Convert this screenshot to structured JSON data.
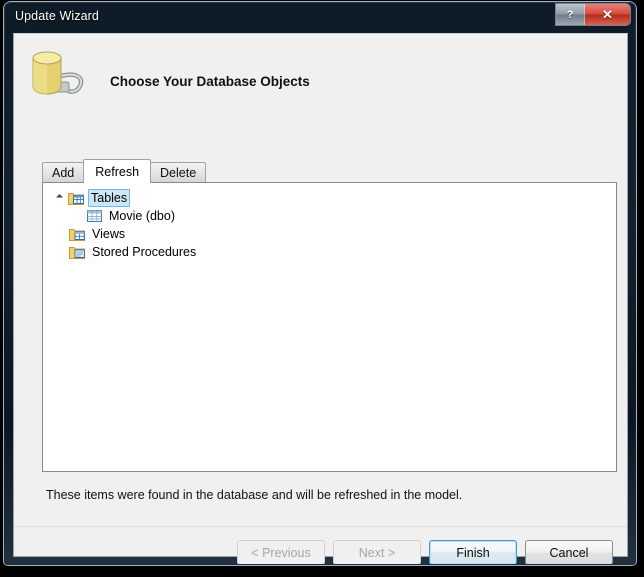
{
  "window": {
    "title": "Update Wizard",
    "help_button_label": "?",
    "close_button_label": "✕"
  },
  "header": {
    "heading": "Choose Your Database Objects",
    "icon": "database-connection-icon"
  },
  "tabs": [
    {
      "label": "Add",
      "name": "tab-add",
      "active": false
    },
    {
      "label": "Refresh",
      "name": "tab-refresh",
      "active": true
    },
    {
      "label": "Delete",
      "name": "tab-delete",
      "active": false
    }
  ],
  "tree": {
    "nodes": [
      {
        "label": "Tables",
        "icon": "tables-folder-icon",
        "expanded": true,
        "selected": true
      },
      {
        "label": "Movie (dbo)",
        "icon": "table-grid-icon",
        "expanded": false,
        "selected": false
      },
      {
        "label": "Views",
        "icon": "views-folder-icon",
        "expanded": false,
        "selected": false
      },
      {
        "label": "Stored Procedures",
        "icon": "stored-procedures-folder-icon",
        "expanded": false,
        "selected": false
      }
    ]
  },
  "status": {
    "message": "These items were found in the database and will be refreshed in the model."
  },
  "buttons": [
    {
      "label": "< Previous",
      "name": "previous-button",
      "state": "disabled"
    },
    {
      "label": "Next >",
      "name": "next-button",
      "state": "disabled"
    },
    {
      "label": "Finish",
      "name": "finish-button",
      "state": "default"
    },
    {
      "label": "Cancel",
      "name": "cancel-button",
      "state": "normal"
    }
  ],
  "colors": {
    "dialog_background": "#f0f0f0",
    "titlebar_dark": "#0d1825",
    "close_button_red": "#c33a2a",
    "selection_blue": "#cde6f7",
    "default_button_border": "#3c9bd6",
    "folder_yellow": "#f5d67a",
    "database_yellow": "#e8dc86"
  }
}
